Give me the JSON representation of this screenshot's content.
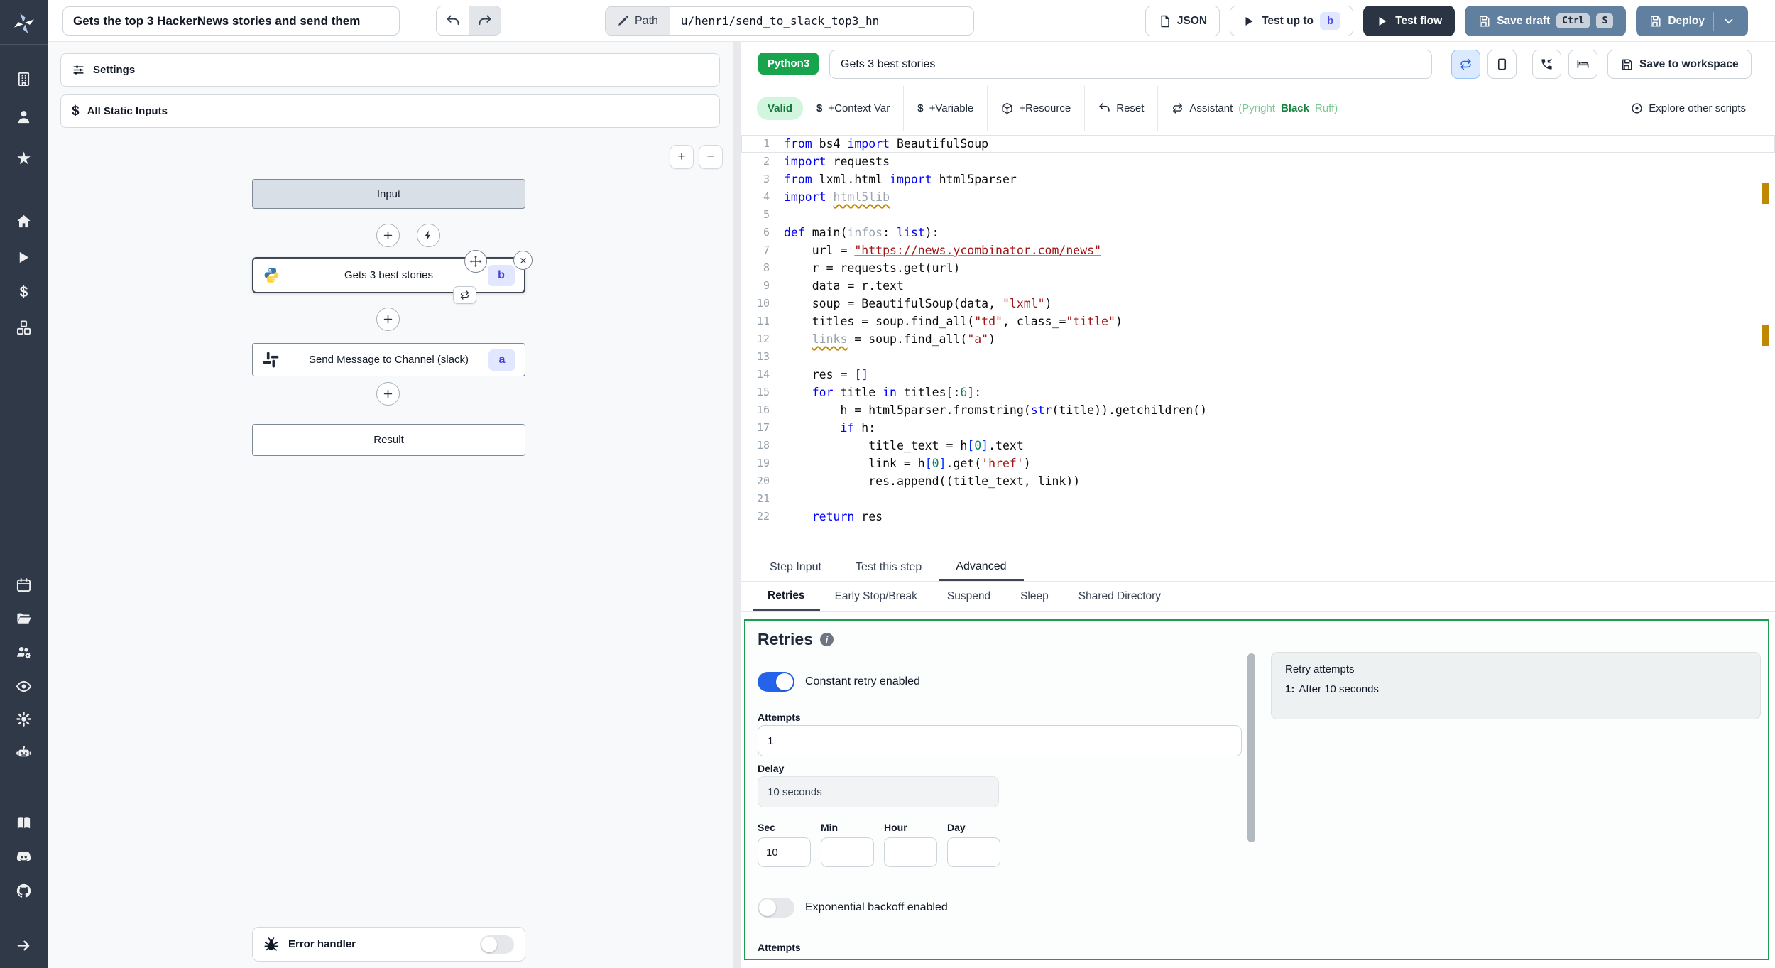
{
  "topbar": {
    "title_value": "Gets the top 3 HackerNews stories and send them",
    "path_label": "Path",
    "path_value": "u/henri/send_to_slack_top3_hn",
    "json_label": "JSON",
    "test_up_to_label": "Test up to",
    "test_up_to_badge": "b",
    "test_flow_label": "Test flow",
    "save_draft_label": "Save draft",
    "kbd_ctrl": "Ctrl",
    "kbd_s": "S",
    "deploy_label": "Deploy"
  },
  "flow": {
    "settings_label": "Settings",
    "static_inputs_label": "All Static Inputs",
    "zoom_in": "+",
    "zoom_out": "−",
    "input_node": "Input",
    "step_b_label": "Gets 3 best stories",
    "step_b_badge": "b",
    "step_a_label": "Send Message to Channel (slack)",
    "step_a_badge": "a",
    "result_node": "Result",
    "error_handler_label": "Error handler"
  },
  "editor": {
    "lang_badge": "Python3",
    "step_title": "Gets 3 best stories",
    "save_to_workspace_label": "Save to workspace",
    "valid_label": "Valid",
    "context_var_label": "+Context Var",
    "variable_label": "+Variable",
    "resource_label": "+Resource",
    "reset_label": "Reset",
    "assistant_label": "Assistant",
    "assistant_pyright": "(Pyright",
    "assistant_black": "Black",
    "assistant_ruff": "Ruff)",
    "explore_label": "Explore other scripts",
    "code_lines": [
      {
        "tokens": [
          [
            "from",
            "k"
          ],
          [
            " bs4 ",
            "d"
          ],
          [
            "import",
            "k"
          ],
          [
            " BeautifulSoup",
            "d"
          ]
        ]
      },
      {
        "tokens": [
          [
            "import",
            "k"
          ],
          [
            " requests",
            "d"
          ]
        ]
      },
      {
        "tokens": [
          [
            "from",
            "k"
          ],
          [
            " lxml.html ",
            "d"
          ],
          [
            "import",
            "k"
          ],
          [
            " html5parser",
            "d"
          ]
        ]
      },
      {
        "tokens": [
          [
            "import",
            "k"
          ],
          [
            " ",
            "d"
          ],
          [
            "html5lib",
            "gw"
          ]
        ]
      },
      {
        "tokens": []
      },
      {
        "tokens": [
          [
            "def",
            "k"
          ],
          [
            " main(",
            "d"
          ],
          [
            "infos",
            "g"
          ],
          [
            ": ",
            "d"
          ],
          [
            "list",
            "k"
          ],
          [
            "):",
            "d"
          ]
        ]
      },
      {
        "tokens": [
          [
            "    url = ",
            "d"
          ],
          [
            "\"https://news.ycombinator.com/news\"",
            "u"
          ]
        ]
      },
      {
        "tokens": [
          [
            "    r = requests.get(url)",
            "d"
          ]
        ]
      },
      {
        "tokens": [
          [
            "    data = r.text",
            "d"
          ]
        ]
      },
      {
        "tokens": [
          [
            "    soup = BeautifulSoup(data, ",
            "d"
          ],
          [
            "\"lxml\"",
            "s"
          ],
          [
            ")",
            "d"
          ]
        ]
      },
      {
        "tokens": [
          [
            "    titles = soup.find_all(",
            "d"
          ],
          [
            "\"td\"",
            "s"
          ],
          [
            ", class_=",
            "d"
          ],
          [
            "\"title\"",
            "s"
          ],
          [
            ")",
            "d"
          ]
        ]
      },
      {
        "tokens": [
          [
            "    ",
            "d"
          ],
          [
            "links",
            "gw"
          ],
          [
            " = soup.find_all(",
            "d"
          ],
          [
            "\"a\"",
            "s"
          ],
          [
            ")",
            "d"
          ]
        ]
      },
      {
        "tokens": []
      },
      {
        "tokens": [
          [
            "    res = ",
            "d"
          ],
          [
            "[]",
            "b1"
          ]
        ]
      },
      {
        "tokens": [
          [
            "    ",
            "d"
          ],
          [
            "for",
            "k"
          ],
          [
            " title ",
            "d"
          ],
          [
            "in",
            "k"
          ],
          [
            " titles",
            "d"
          ],
          [
            "[",
            "b1"
          ],
          [
            ":",
            "d"
          ],
          [
            "6",
            "n"
          ],
          [
            "]",
            "b1"
          ],
          [
            ":",
            "d"
          ]
        ]
      },
      {
        "tokens": [
          [
            "        h = html5parser.fromstring(",
            "d"
          ],
          [
            "str",
            "k"
          ],
          [
            "(title)).getchildren()",
            "d"
          ]
        ]
      },
      {
        "tokens": [
          [
            "        ",
            "d"
          ],
          [
            "if",
            "k"
          ],
          [
            " h:",
            "d"
          ]
        ]
      },
      {
        "tokens": [
          [
            "            title_text = h",
            "d"
          ],
          [
            "[",
            "b1"
          ],
          [
            "0",
            "n"
          ],
          [
            "]",
            "b1"
          ],
          [
            ".text",
            "d"
          ]
        ]
      },
      {
        "tokens": [
          [
            "            link = h",
            "d"
          ],
          [
            "[",
            "b1"
          ],
          [
            "0",
            "n"
          ],
          [
            "]",
            "b1"
          ],
          [
            ".get(",
            "d"
          ],
          [
            "'href'",
            "s"
          ],
          [
            ")",
            "d"
          ]
        ]
      },
      {
        "tokens": [
          [
            "            res.append((title_text, link))",
            "d"
          ]
        ]
      },
      {
        "tokens": []
      },
      {
        "tokens": [
          [
            "    ",
            "d"
          ],
          [
            "return",
            "k"
          ],
          [
            " res",
            "d"
          ]
        ]
      }
    ]
  },
  "tabs": {
    "main": [
      "Step Input",
      "Test this step",
      "Advanced"
    ],
    "main_active": "Advanced",
    "sub": [
      "Retries",
      "Early Stop/Break",
      "Suspend",
      "Sleep",
      "Shared Directory"
    ],
    "sub_active": "Retries"
  },
  "retries": {
    "title": "Retries",
    "info_icon": "i",
    "constant_label": "Constant retry enabled",
    "attempts_label": "Attempts",
    "attempts_value": "1",
    "delay_label": "Delay",
    "delay_value": "10 seconds",
    "time_fields": [
      {
        "label": "Sec",
        "value": "10"
      },
      {
        "label": "Min",
        "value": ""
      },
      {
        "label": "Hour",
        "value": ""
      },
      {
        "label": "Day",
        "value": ""
      }
    ],
    "backoff_label": "Exponential backoff enabled",
    "attempts2_label": "Attempts",
    "summary_title": "Retry attempts",
    "summary_items": [
      {
        "n": "1:",
        "text": "After 10 seconds"
      }
    ]
  },
  "sidebar_icons": [
    "windmill-logo",
    "workspace",
    "user",
    "favorites",
    "home",
    "runs",
    "variables",
    "resources",
    "schedules",
    "folders",
    "groups",
    "audit-logs",
    "settings",
    "ai",
    "docs",
    "discord",
    "github",
    "collapse"
  ],
  "colors": {
    "sidebar_bg": "#303948",
    "accent_green": "#1d9d4f",
    "lang_badge_green": "#18a34d",
    "toggle_blue": "#2563eb",
    "button_blue": "#61809f",
    "dark_button": "#2b3443",
    "badge_indigo_bg": "#e0e7ff",
    "badge_indigo_text": "#4f46e5",
    "warning_marker": "#bf8803",
    "valid_bg": "#d2f5dd",
    "valid_text": "#147a3e"
  }
}
